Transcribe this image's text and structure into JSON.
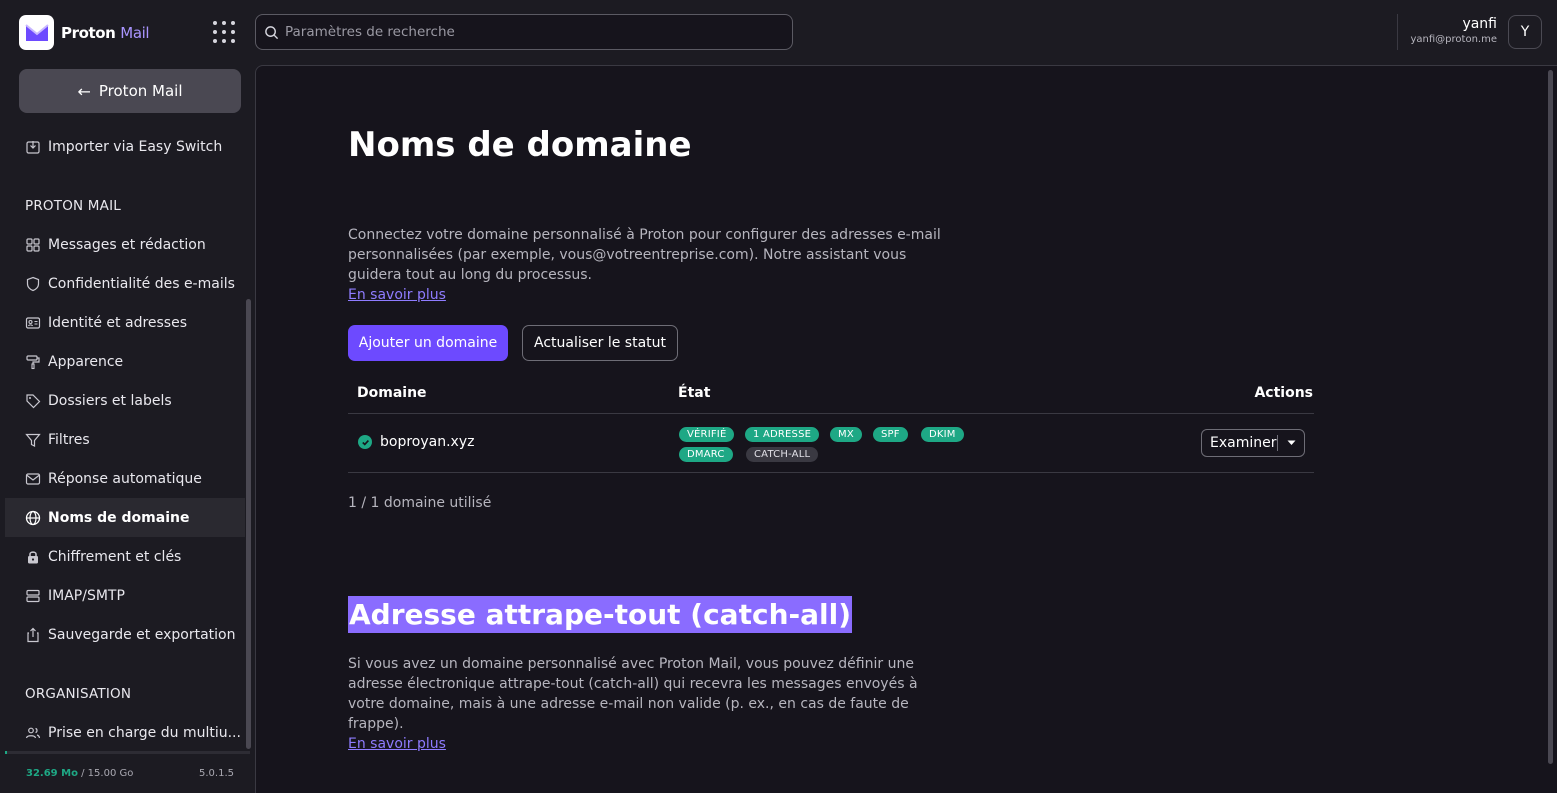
{
  "header": {
    "brand_name": "Proton",
    "brand_product": "Mail",
    "search_placeholder": "Paramètres de recherche",
    "user_name": "yanfi",
    "user_email": "yanfi@proton.me",
    "avatar_initial": "Y"
  },
  "sidebar": {
    "back_label": "Proton Mail",
    "import_label": "Importer via Easy Switch",
    "section_mail": "PROTON MAIL",
    "items": [
      {
        "label": "Messages et rédaction",
        "icon": "grid-icon"
      },
      {
        "label": "Confidentialité des e-mails",
        "icon": "shield-icon"
      },
      {
        "label": "Identité et adresses",
        "icon": "id-card-icon"
      },
      {
        "label": "Apparence",
        "icon": "paint-roller-icon"
      },
      {
        "label": "Dossiers et labels",
        "icon": "tag-icon"
      },
      {
        "label": "Filtres",
        "icon": "filter-icon"
      },
      {
        "label": "Réponse automatique",
        "icon": "envelope-icon"
      },
      {
        "label": "Noms de domaine",
        "icon": "globe-icon",
        "active": true
      },
      {
        "label": "Chiffrement et clés",
        "icon": "lock-icon"
      },
      {
        "label": "IMAP/SMTP",
        "icon": "servers-icon"
      },
      {
        "label": "Sauvegarde et exportation",
        "icon": "export-icon"
      }
    ],
    "section_org": "ORGANISATION",
    "org_item": "Prise en charge du multiu...",
    "storage_used": "32.69 Mo",
    "storage_total": "/ 15.00 Go",
    "storage_fraction": 0.002,
    "version": "5.0.1.5"
  },
  "main": {
    "title": "Noms de domaine",
    "description": "Connectez votre domaine personnalisé à Proton pour configurer des adresses e-mail personnalisées (par exemple, vous@votreentreprise.com). Notre assistant vous guidera tout au long du processus.",
    "learn_more": "En savoir plus",
    "add_domain": "Ajouter un domaine",
    "refresh_status": "Actualiser le statut",
    "table": {
      "col_domain": "Domaine",
      "col_state": "État",
      "col_actions": "Actions",
      "rows": [
        {
          "domain": "boproyan.xyz",
          "badges": [
            "VÉRIFIÉ",
            "1 ADRESSE",
            "MX",
            "SPF",
            "DKIM",
            "DMARC",
            "CATCH-ALL"
          ],
          "action": "Examiner"
        }
      ]
    },
    "usage": "1 / 1 domaine utilisé",
    "catchall_title": "Adresse attrape-tout (catch-all)",
    "catchall_description": "Si vous avez un domaine personnalisé avec Proton Mail, vous pouvez définir une adresse électronique attrape-tout (catch-all) qui recevra les messages envoyés à votre domaine, mais à une adresse e-mail non valide (p. ex., en cas de faute de frappe).",
    "catchall_learn_more": "En savoir plus"
  },
  "colors": {
    "accent": "#6d4aff",
    "success": "#1ea885",
    "highlight": "#8a6cff"
  }
}
